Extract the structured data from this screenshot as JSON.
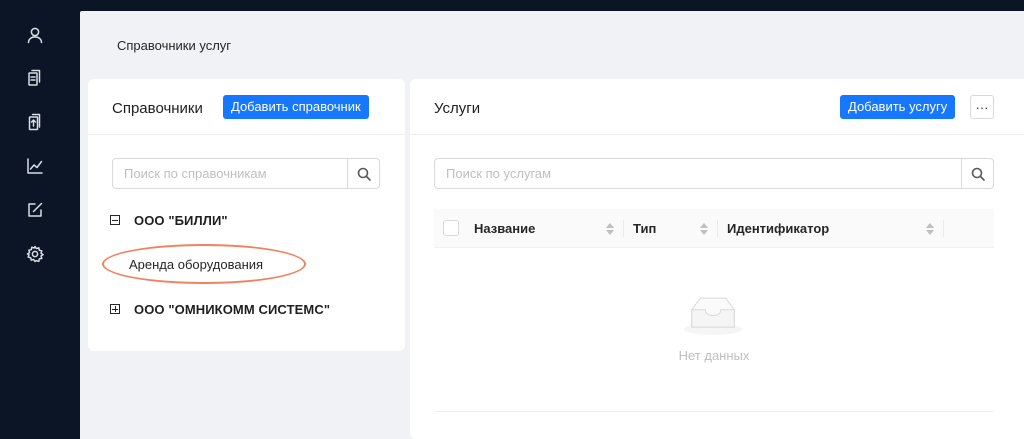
{
  "sidebar": {
    "icons": [
      "user-icon",
      "copy-icon",
      "document-icon",
      "chart-icon",
      "edit-icon",
      "gear-icon"
    ]
  },
  "page": {
    "title": "Справочники услуг"
  },
  "left_panel": {
    "title": "Справочники",
    "add_button": "Добавить справочник",
    "search_placeholder": "Поиск по справочникам",
    "tree": [
      {
        "label": "ООО \"БИЛЛИ\"",
        "expanded": true,
        "children": [
          "Аренда оборудования"
        ]
      },
      {
        "label": "ООО \"ОМНИКОММ СИСТЕМС\"",
        "expanded": false,
        "children": []
      }
    ]
  },
  "right_panel": {
    "title": "Услуги",
    "add_button": "Добавить услугу",
    "more_button": "···",
    "search_placeholder": "Поиск по услугам",
    "table": {
      "columns": [
        "Название",
        "Тип",
        "Идентификатор"
      ],
      "empty_text": "Нет данных"
    }
  },
  "colors": {
    "primary": "#1677ff",
    "sidebar": "#0b1525",
    "highlight": "#f0835f"
  }
}
